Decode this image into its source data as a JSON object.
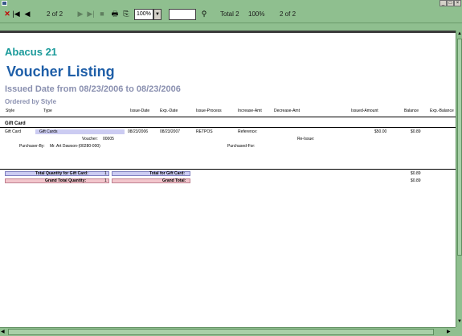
{
  "toolbar": {
    "page_display": "2 of 2",
    "zoom": "100%",
    "search_value": "",
    "status_total": "Total 2",
    "status_zoom": "100%",
    "status_page": "2 of 2"
  },
  "report": {
    "company": "Abacus 21",
    "title": "Voucher Listing",
    "issued_date": "Issued Date from 08/23/2006 to 08/23/2006",
    "ordered_by": "Ordered by Style",
    "columns": [
      "Style",
      "Type",
      "Issue-Date",
      "Exp.-Date",
      "Issue-Process",
      "Increase-Amt",
      "Decrease-Amt",
      "Issued-Amount",
      "Balance",
      "Exp.-Balance"
    ],
    "section_title": "Gift Card",
    "row": {
      "style": "Gift Card",
      "type": "Gift Cards",
      "issue_date": "08/23/2006",
      "exp_date": "08/23/2007",
      "issue_process": "RETPOS",
      "reference_label": "Reference:",
      "issued_amount": "$50.00",
      "balance": "$0.89",
      "voucher_label": "Voucher:",
      "voucher_number": "00005",
      "reissue_label": "Re-Issue:",
      "purchaser_label": "Purchaser-By:",
      "purchaser_name": "Mr. Art Dawson-(00280-000)",
      "purchased_for_label": "Purchased-For:"
    },
    "totals": {
      "qty_label": "Total Quantity for Gift Card:",
      "qty_value": "1",
      "total_label": "Total for Gift Card:",
      "total_value": "$0.89",
      "grand_qty_label": "Grand Total Quantity:",
      "grand_qty_value": "1",
      "grand_total_label": "Grand Total:",
      "grand_total_value": "$0.89"
    }
  },
  "colors": {
    "chrome": "#8fbf8f",
    "company": "#1a9a9a",
    "title": "#1f5fa8",
    "subtitle": "#8a90b0",
    "band_blue": "#ccccf2",
    "band_pink": "#f2c6cc"
  }
}
